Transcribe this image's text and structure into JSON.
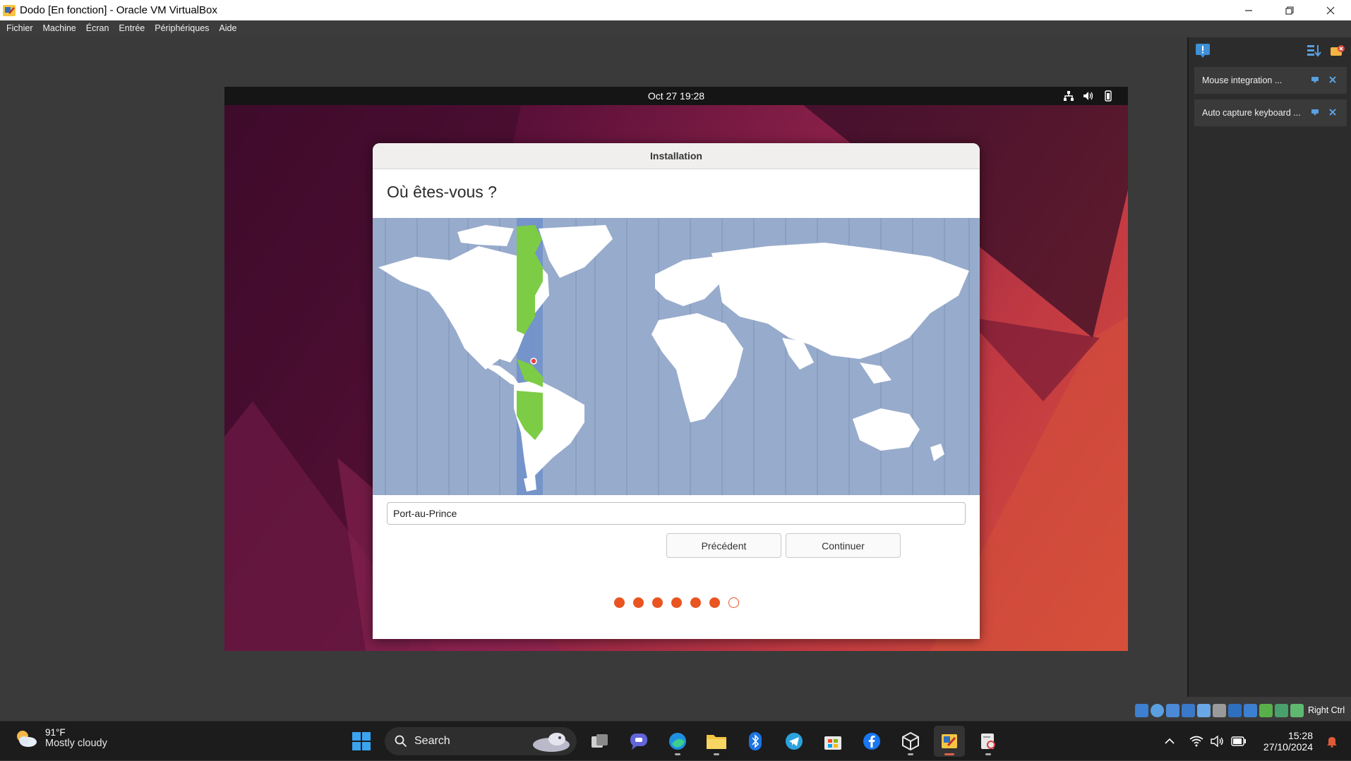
{
  "window": {
    "title": "Dodo [En fonction] - Oracle VM VirtualBox",
    "minimize_icon": "minimize-icon",
    "restore_icon": "restore-icon",
    "close_icon": "close-icon"
  },
  "menubar": {
    "items": [
      "Fichier",
      "Machine",
      "Écran",
      "Entrée",
      "Périphériques",
      "Aide"
    ]
  },
  "side_panel": {
    "messages": [
      {
        "text": "Mouse integration ..."
      },
      {
        "text": "Auto capture keyboard ..."
      }
    ]
  },
  "vbox_status": {
    "host_key": "Right Ctrl"
  },
  "guest": {
    "topbar": {
      "clock": "Oct 27  19:28"
    },
    "installer": {
      "header": "Installation",
      "question": "Où êtes-vous ?",
      "timezone_value": "Port-au-Prince",
      "back_label": "Précédent",
      "continue_label": "Continuer",
      "progress": {
        "total_steps": 7,
        "completed_steps": 6
      }
    }
  },
  "taskbar": {
    "weather": {
      "temp": "91°F",
      "condition": "Mostly cloudy"
    },
    "search_label": "Search",
    "clock": {
      "time": "15:28",
      "date": "27/10/2024"
    }
  },
  "colors": {
    "ubuntu_orange": "#e95420",
    "map_ocean": "#97abcc",
    "map_highlight": "#7dcc46"
  }
}
